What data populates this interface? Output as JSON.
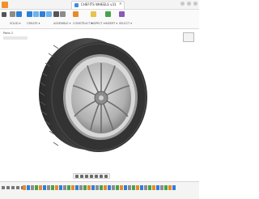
{
  "window": {
    "tab_label": "CHEFITS WHEELS v31",
    "tab_close": "×"
  },
  "ribbon": {
    "groups": [
      {
        "label": "SOLID ▾",
        "icons": [
          "new-sketch-icon",
          "extrude-icon"
        ]
      },
      {
        "label": "CREATE ▾",
        "icons": [
          "box-icon",
          "cylinder-icon",
          "sphere-icon",
          "pattern-icon"
        ]
      },
      {
        "label": "ASSEMBLE ▾",
        "icons": [
          "move-icon",
          "joint-icon"
        ]
      },
      {
        "label": "CONSTRUCT ▾",
        "icons": [
          "plane-icon"
        ]
      },
      {
        "label": "INSPECT ▾",
        "icons": [
          "measure-icon"
        ]
      },
      {
        "label": "INSERT ▾",
        "icons": [
          "insert-image-icon"
        ]
      },
      {
        "label": "SELECT ▾",
        "icons": [
          "select-icon"
        ]
      }
    ]
  },
  "browser": {
    "label": "Parts 2"
  },
  "colors": {
    "accent": "#2f7fd6",
    "tire": "#3a3a3a",
    "rim": "#b8b8b8",
    "timeline_feature": "#e88a2a"
  },
  "navbar": {
    "icons": [
      "orbit-icon",
      "pan-icon",
      "zoom-icon",
      "fit-icon",
      "display-icon",
      "grid-icon",
      "viewport-icon"
    ]
  },
  "timeline": {
    "controls": [
      "first-icon",
      "prev-icon",
      "play-icon",
      "next-icon",
      "last-icon"
    ],
    "feature_count": 38
  }
}
